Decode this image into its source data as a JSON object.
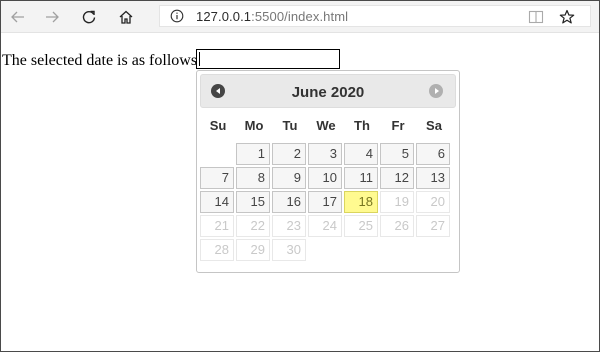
{
  "browser": {
    "url_host": "127.0.0.1",
    "url_rest": ":5500/index.html"
  },
  "page": {
    "label": "The selected date is as follows:",
    "input_value": ""
  },
  "datepicker": {
    "title": "June 2020",
    "weekdays": [
      "Su",
      "Mo",
      "Tu",
      "We",
      "Th",
      "Fr",
      "Sa"
    ],
    "first_weekday_index": 1,
    "days_in_month": 30,
    "today": 18,
    "last_enabled_day": 18,
    "colors": {
      "today_bg": "#fffa90",
      "default_bg": "#f6f6f6",
      "disabled_text": "#c9c9c9"
    }
  }
}
